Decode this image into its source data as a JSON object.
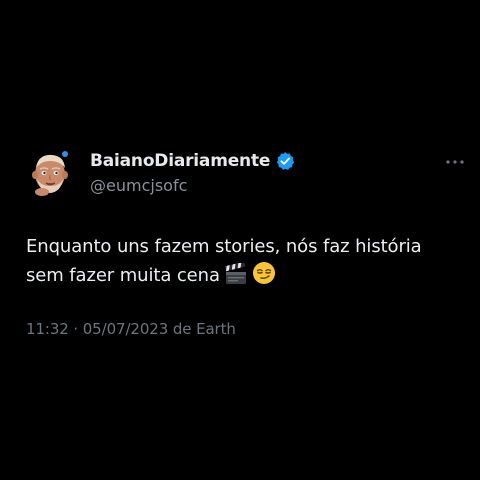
{
  "tweet": {
    "author": {
      "display_name": "BaianoDiariamente",
      "handle": "@eumcjsofc",
      "verified": true
    },
    "text_line1": "Enquanto uns fazem stories, nós faz história",
    "text_line2": "sem fazer muita cena",
    "emojis": [
      "clapper-board-icon",
      "smirking-face-icon"
    ],
    "timestamp": "11:32 · 05/07/2023 de Earth"
  },
  "colors": {
    "background": "#000000",
    "text_primary": "#e7e9ea",
    "text_secondary": "#6e767d",
    "verified_blue": "#1d9bf0"
  },
  "icons": {
    "more": "more-horizontal-icon",
    "verified": "verified-badge-icon"
  }
}
